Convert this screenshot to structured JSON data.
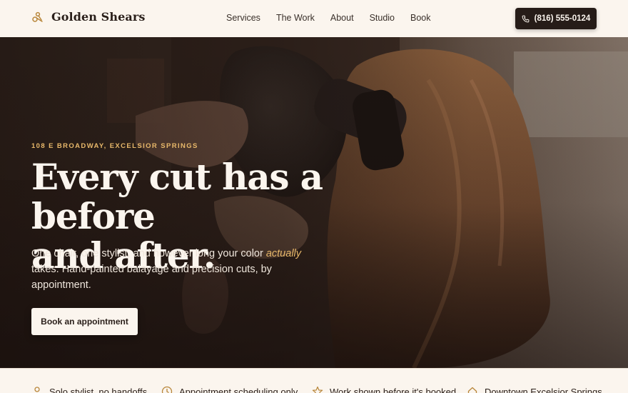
{
  "brand": {
    "name": "Golden Shears",
    "logo_icon": "scissors-icon"
  },
  "nav": {
    "items": [
      "Services",
      "The Work",
      "About",
      "Studio",
      "Book"
    ]
  },
  "phone": {
    "label": "(816) 555-0124",
    "icon": "phone-icon"
  },
  "hero": {
    "eyebrow": "108 E BROADWAY, EXCELSIOR SPRINGS",
    "headline_line1": "Every cut has a before",
    "headline_line2": "and after.",
    "sub_part1": "One chair, one stylist, and however long your color ",
    "sub_emphasis": "actually",
    "sub_part2": " takes. Hand-painted balayage and precision cuts, by appointment.",
    "cta_label": "Book an appointment"
  },
  "features": [
    {
      "icon": "person-icon",
      "label": "Solo stylist, no handoffs"
    },
    {
      "icon": "clock-icon",
      "label": "Appointment scheduling only"
    },
    {
      "icon": "star-icon",
      "label": "Work shown before it's booked"
    },
    {
      "icon": "home-icon",
      "label": "Downtown Excelsior Springs"
    }
  ],
  "colors": {
    "background": "#fbf5ee",
    "dark": "#261c18",
    "accent": "#e8b86a",
    "icon_accent": "#b8863a"
  }
}
